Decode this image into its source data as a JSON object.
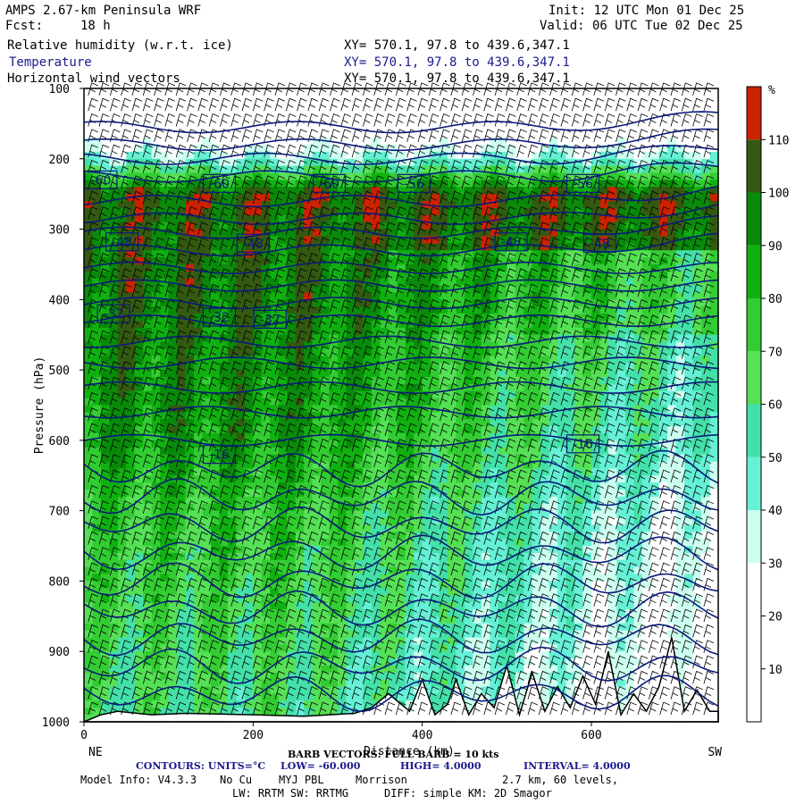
{
  "header": {
    "model_title": "AMPS 2.67-km Peninsula WRF",
    "init": "Init: 12 UTC Mon 01 Dec 25",
    "fcst_label": "Fcst:",
    "fcst_value": "18 h",
    "valid": "Valid: 06 UTC Tue 02 Dec 25",
    "fields": [
      {
        "name": "Relative humidity (w.r.t. ice)",
        "xy": "XY= 570.1, 97.8 to 439.6,347.1"
      },
      {
        "name": "Temperature",
        "xy": "XY= 570.1, 97.8 to 439.6,347.1"
      },
      {
        "name": "Horizontal wind vectors",
        "xy": "XY= 570.1, 97.8 to 439.6,347.1"
      }
    ]
  },
  "chart_data": {
    "type": "heatmap",
    "ylabel": "Pressure (hPa)",
    "xlabel": "Distance (km)",
    "x_left_label": "NE",
    "x_right_label": "SW",
    "xlim": [
      0,
      750
    ],
    "ylim": [
      1000,
      100
    ],
    "x_ticks": [
      0,
      200,
      400,
      600
    ],
    "y_ticks": [
      100,
      200,
      300,
      400,
      500,
      600,
      700,
      800,
      900,
      1000
    ],
    "colorbar": {
      "unit": "%",
      "levels": [
        0,
        10,
        20,
        30,
        40,
        50,
        60,
        70,
        80,
        90,
        100,
        110,
        120
      ],
      "labels": [
        10,
        20,
        30,
        40,
        50,
        60,
        70,
        80,
        90,
        100,
        110
      ],
      "colors": [
        "#ffffff",
        "#ffffff",
        "#ffffff",
        "#ccfff0",
        "#66f0d6",
        "#44e0aa",
        "#55e055",
        "#33cc33",
        "#11b011",
        "#0a8a0a",
        "#335a10",
        "#cc2200"
      ]
    },
    "relative_humidity_profile": [
      {
        "pressure": 150,
        "rh": 5
      },
      {
        "pressure": 200,
        "rh": 40
      },
      {
        "pressure": 250,
        "rh": 105
      },
      {
        "pressure": 300,
        "rh": 100
      },
      {
        "pressure": 400,
        "rh": 98
      },
      {
        "pressure": 500,
        "rh": 92
      },
      {
        "pressure": 600,
        "rh": 88
      },
      {
        "pressure": 700,
        "rh": 75
      },
      {
        "pressure": 800,
        "rh": 70
      },
      {
        "pressure": 900,
        "rh": 65
      },
      {
        "pressure": 1000,
        "rh": 60
      }
    ],
    "temperature_contour_labels": [
      {
        "x": 20,
        "p": 230,
        "text": "-60"
      },
      {
        "x": 160,
        "p": 235,
        "text": "-60"
      },
      {
        "x": 290,
        "p": 235,
        "text": "-60"
      },
      {
        "x": 390,
        "p": 235,
        "text": "-56"
      },
      {
        "x": 590,
        "p": 235,
        "text": "-56"
      },
      {
        "x": 45,
        "p": 318,
        "text": "-48"
      },
      {
        "x": 200,
        "p": 320,
        "text": "-48"
      },
      {
        "x": 505,
        "p": 318,
        "text": "-48"
      },
      {
        "x": 610,
        "p": 320,
        "text": "-48"
      },
      {
        "x": 35,
        "p": 420,
        "text": "-32"
      },
      {
        "x": 160,
        "p": 425,
        "text": "-32"
      },
      {
        "x": 220,
        "p": 428,
        "text": "-32"
      },
      {
        "x": 160,
        "p": 620,
        "text": "-16"
      },
      {
        "x": 590,
        "p": 605,
        "text": "-16"
      }
    ],
    "contour_info": {
      "units": "CONTOURS: UNITS=°C",
      "low": "LOW= -60.000",
      "high": "HIGH= 4.0000",
      "interval": "INTERVAL= 4.0000"
    },
    "barb_info": "BARB VECTORS: FULL BARB = 10 kts"
  },
  "model_info": {
    "line1_a": "Model Info: V4.3.3",
    "line1_b": "No Cu",
    "line1_c": "MYJ PBL",
    "line1_d": "Morrison",
    "line1_e": "2.7 km, 60 levels,",
    "line2_a": "LW: RRTM SW: RRTMG",
    "line2_b": "DIFF: simple KM: 2D Smagor"
  },
  "colors": {
    "contour": "#0b1a7a",
    "barb": "#000000"
  }
}
